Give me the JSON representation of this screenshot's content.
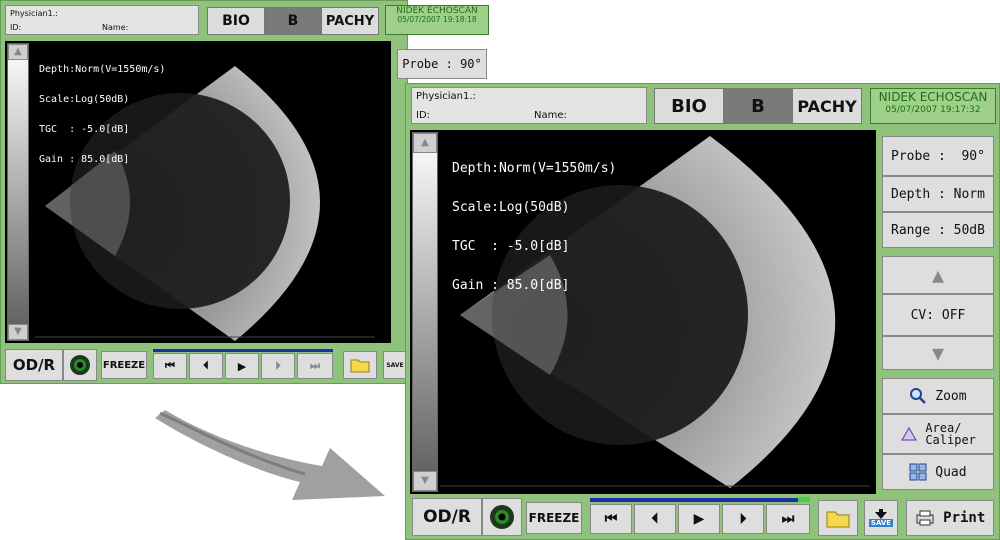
{
  "back": {
    "patient_label_physician": "Physician1.:",
    "patient_label_id": "ID:",
    "patient_label_name": "Name:",
    "modes": [
      "BIO",
      "B",
      "PACHY"
    ],
    "brand": "NIDEK ECHOSCAN",
    "datetime": "05/07/2007 19:18:18",
    "probe_label": "Probe :",
    "probe_value": "90°",
    "info_depth": "Depth:Norm(V=1550m/s)",
    "info_scale": "Scale:Log(50dB)",
    "info_tgc": "TGC  : -5.0[dB]",
    "info_gain": "Gain : 85.0[dB]",
    "odr": "OD/R",
    "freeze": "FREEZE",
    "save": "SAVE"
  },
  "front": {
    "patient_label_physician": "Physician1.:",
    "patient_label_id": "ID:",
    "patient_label_name": "Name:",
    "modes": [
      "BIO",
      "B",
      "PACHY"
    ],
    "brand": "NIDEK ECHOSCAN",
    "datetime": "05/07/2007 19:17:32",
    "info_depth": "Depth:Norm(V=1550m/s)",
    "info_scale": "Scale:Log(50dB)",
    "info_tgc": "TGC  : -5.0[dB]",
    "info_gain": "Gain : 85.0[dB]",
    "probe_label": "Probe :",
    "probe_value": "90°",
    "depth_label": "Depth : Norm",
    "range_label": "Range : 50dB",
    "cv_label": "CV: OFF",
    "zoom": "Zoom",
    "area_caliper_1": "Area/",
    "area_caliper_2": "Caliper",
    "quad": "Quad",
    "odr": "OD/R",
    "freeze": "FREEZE",
    "save": "SAVE",
    "print": "Print"
  },
  "colors": {
    "panel_green": "#8fc27a",
    "brand_text": "#1d6e16",
    "button_gray": "#dedede",
    "active_mode": "#7a7a7a"
  }
}
